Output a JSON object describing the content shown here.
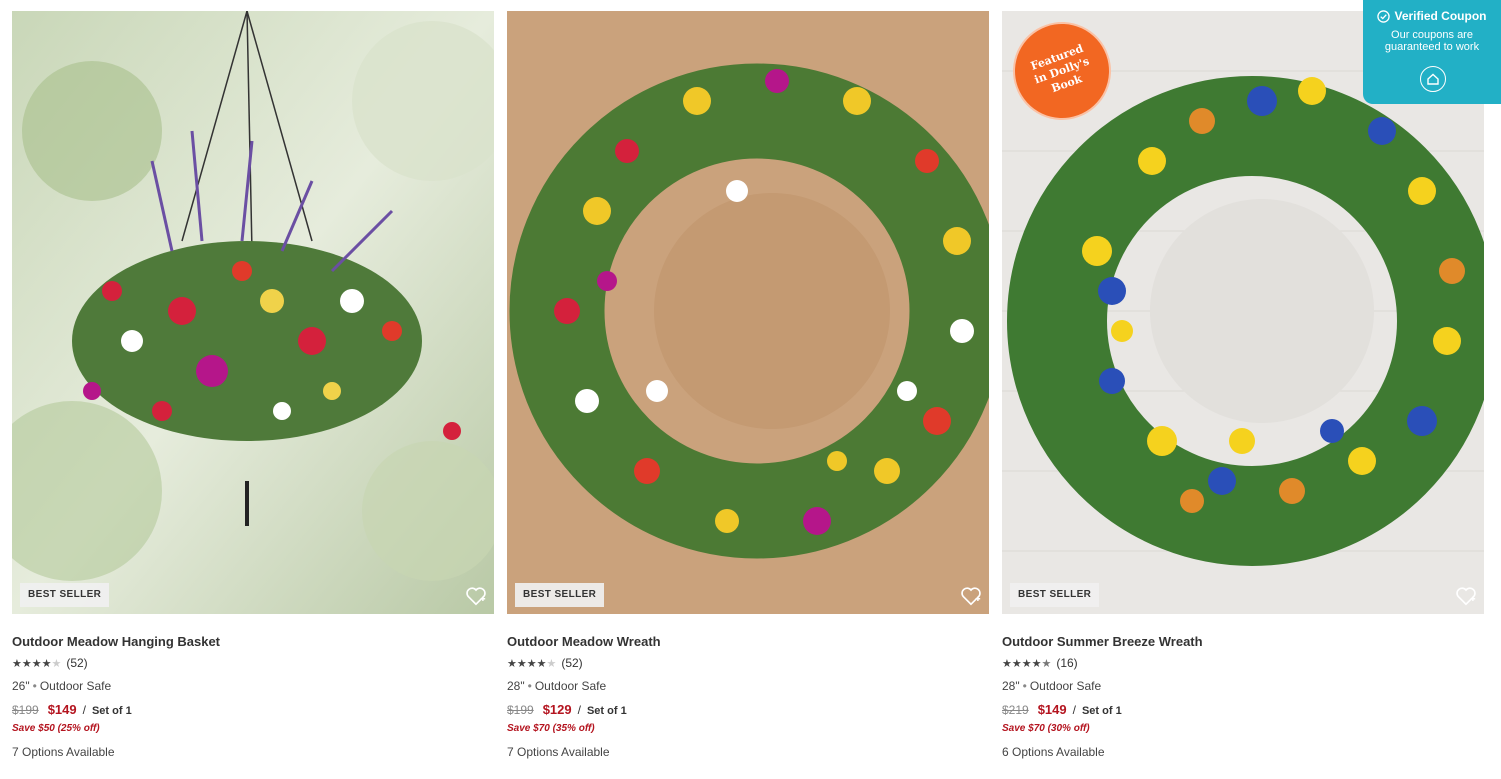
{
  "coupon": {
    "title": "Verified Coupon",
    "description": "Our coupons are guaranteed to work"
  },
  "products": [
    {
      "badge": "BEST SELLER",
      "title": "Outdoor Meadow Hanging Basket",
      "rating": 4.0,
      "review_count": "(52)",
      "size": "26\"",
      "feature": "Outdoor Safe",
      "old_price": "$199",
      "price": "$149",
      "set": "Set of 1",
      "save": "Save $50 (25% off)",
      "options": "7 Options Available"
    },
    {
      "badge": "BEST SELLER",
      "title": "Outdoor Meadow Wreath",
      "rating": 4.0,
      "review_count": "(52)",
      "size": "28\"",
      "feature": "Outdoor Safe",
      "old_price": "$199",
      "price": "$129",
      "set": "Set of 1",
      "save": "Save $70 (35% off)",
      "options": "7 Options Available"
    },
    {
      "badge": "BEST SELLER",
      "featured_badge": "Featured\nin Dolly's\nBook",
      "title": "Outdoor Summer Breeze Wreath",
      "rating": 4.5,
      "review_count": "(16)",
      "size": "28\"",
      "feature": "Outdoor Safe",
      "old_price": "$219",
      "price": "$149",
      "set": "Set of 1",
      "save": "Save $70 (30% off)",
      "options": "6 Options Available"
    }
  ],
  "colors": {
    "sale_red": "#b4141f",
    "featured_orange": "#f26722",
    "coupon_teal": "#22b0c6"
  }
}
